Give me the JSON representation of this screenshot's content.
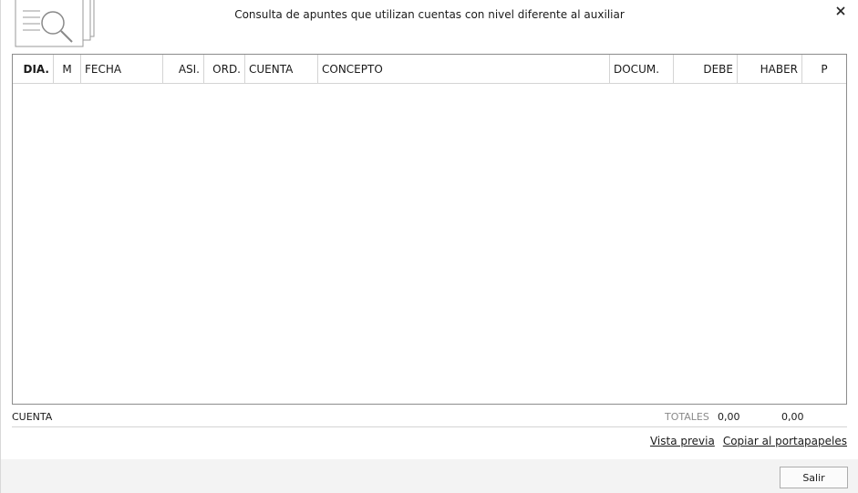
{
  "window": {
    "title": "Consulta de apuntes que utilizan cuentas con nivel diferente al auxiliar",
    "close_icon": "close-icon",
    "header_icon": "document-search-icon"
  },
  "grid": {
    "columns": [
      {
        "key": "dia",
        "label": "DIA."
      },
      {
        "key": "m",
        "label": "M"
      },
      {
        "key": "fecha",
        "label": "FECHA"
      },
      {
        "key": "asi",
        "label": "ASI."
      },
      {
        "key": "ord",
        "label": "ORD."
      },
      {
        "key": "cuenta",
        "label": "CUENTA"
      },
      {
        "key": "concepto",
        "label": "CONCEPTO"
      },
      {
        "key": "docum",
        "label": "DOCUM."
      },
      {
        "key": "debe",
        "label": "DEBE"
      },
      {
        "key": "haber",
        "label": "HABER"
      },
      {
        "key": "p",
        "label": "P"
      }
    ],
    "rows": []
  },
  "summary": {
    "cuenta_label": "CUENTA",
    "totales_label": "TOTALES",
    "total_debe": "0,00",
    "total_haber": "0,00"
  },
  "links": {
    "vista_previa": "Vista previa",
    "copiar": "Copiar al portapapeles"
  },
  "footer": {
    "salir_label": "Salir"
  },
  "colors": {
    "footer_bg": "#f3f3f3",
    "grid_border": "#8c8c8c",
    "totales_label": "#8a8a8a"
  }
}
